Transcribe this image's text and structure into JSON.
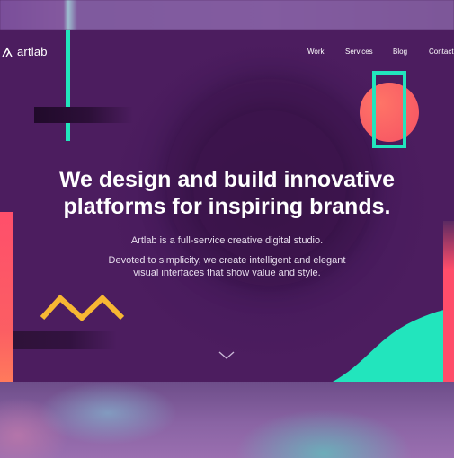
{
  "brand": {
    "name": "artlab"
  },
  "nav": {
    "items": [
      "Work",
      "Services",
      "Blog",
      "Contact"
    ]
  },
  "hero": {
    "headline_line1": "We design and build innovative",
    "headline_line2": "platforms for inspiring brands.",
    "tagline": "Artlab is a full-service creative digital studio.",
    "description_line1": "Devoted to simplicity, we create intelligent and elegant",
    "description_line2": "visual interfaces that show value and style."
  },
  "icons": {
    "logo": "triangle-logo-icon",
    "scroll": "chevron-down-icon"
  },
  "colors": {
    "background": "#4c1d5f",
    "accent_teal": "#22e5bd",
    "accent_coral": "#f55163",
    "accent_yellow": "#f7b733",
    "text": "#ffffff"
  }
}
